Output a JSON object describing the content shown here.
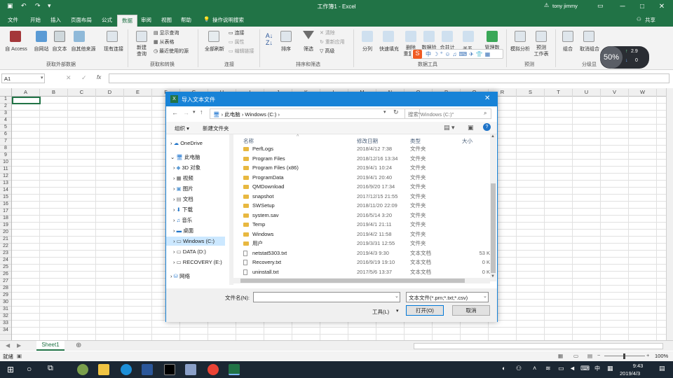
{
  "window": {
    "title": "工作簿1 - Excel",
    "user": "tony jimmy",
    "share": "共享"
  },
  "tabs": [
    "文件",
    "开始",
    "插入",
    "页面布局",
    "公式",
    "数据",
    "审阅",
    "视图",
    "帮助",
    "操作说明搜索"
  ],
  "ribbon": {
    "get_external": {
      "buttons": [
        "自 Access",
        "自网站",
        "自文本",
        "自其他来源",
        "现有连接"
      ],
      "group": "获取外部数据"
    },
    "get_transform": {
      "new_query": "新建\n查询",
      "items": [
        "显示查询",
        "从表格",
        "最近使用的源"
      ],
      "group": "获取和转换"
    },
    "connections": {
      "refresh": "全部刷新",
      "items": [
        "连接",
        "属性",
        "编辑链接"
      ],
      "group": "连接"
    },
    "sort_filter": {
      "buttons": [
        "排序",
        "筛选"
      ],
      "items": [
        "清除",
        "重新应用",
        "高级"
      ],
      "group": "排序和筛选"
    },
    "data_tools": {
      "buttons": [
        "分列",
        "快速填充",
        "删除\n重复项",
        "数据验\n证",
        "合并计\n算",
        "关系",
        "管理数\n据模型"
      ],
      "group": "数据工具"
    },
    "forecast": {
      "buttons": [
        "模拟分析",
        "预测\n工作表"
      ],
      "group": "预测"
    },
    "outline": {
      "buttons": [
        "组合",
        "取消组合",
        "分类汇总"
      ],
      "group": "分级显示"
    }
  },
  "ime_percent": "50%",
  "net": {
    "up": "2.9",
    "down": "0"
  },
  "formula_bar": {
    "namebox": "A1",
    "fx": "fx"
  },
  "columns": [
    "A",
    "B",
    "C",
    "D",
    "E",
    "F",
    "G",
    "H",
    "I",
    "J",
    "K",
    "L",
    "M",
    "N",
    "O",
    "P",
    "Q",
    "R",
    "S",
    "T",
    "U",
    "V",
    "W"
  ],
  "rows": [
    "1",
    "2",
    "3",
    "4",
    "5",
    "6",
    "7",
    "8",
    "9",
    "10",
    "11",
    "12",
    "13",
    "14",
    "15",
    "16",
    "17",
    "18",
    "19",
    "20",
    "21",
    "22",
    "23",
    "24",
    "25",
    "26",
    "27",
    "28",
    "29",
    "30",
    "31",
    "32",
    "33",
    "34"
  ],
  "sheet": {
    "name": "Sheet1",
    "status": "就绪",
    "zoom": "100%"
  },
  "dialog": {
    "title": "导入文本文件",
    "breadcrumb": [
      "此电脑",
      "Windows (C:)"
    ],
    "search_placeholder": "搜索\"Windows (C:)\"",
    "organize": "组织 ▾",
    "new_folder": "新建文件夹",
    "nav": [
      {
        "label": "OneDrive"
      },
      {
        "label": "此电脑"
      },
      {
        "label": "3D 对象"
      },
      {
        "label": "视频"
      },
      {
        "label": "图片"
      },
      {
        "label": "文档"
      },
      {
        "label": "下载"
      },
      {
        "label": "音乐"
      },
      {
        "label": "桌面"
      },
      {
        "label": "Windows (C:)"
      },
      {
        "label": "DATA (D:)"
      },
      {
        "label": "RECOVERY (E:)"
      },
      {
        "label": "网络"
      }
    ],
    "headers": {
      "name": "名称",
      "date": "修改日期",
      "type": "类型",
      "size": "大小"
    },
    "files": [
      {
        "name": "PerfLogs",
        "date": "2018/4/12 7:38",
        "type": "文件夹",
        "size": "",
        "folder": true
      },
      {
        "name": "Program Files",
        "date": "2018/12/16 13:34",
        "type": "文件夹",
        "size": "",
        "folder": true
      },
      {
        "name": "Program Files (x86)",
        "date": "2019/4/1 10:24",
        "type": "文件夹",
        "size": "",
        "folder": true
      },
      {
        "name": "ProgramData",
        "date": "2019/4/1 20:40",
        "type": "文件夹",
        "size": "",
        "folder": true
      },
      {
        "name": "QMDownload",
        "date": "2016/9/20 17:34",
        "type": "文件夹",
        "size": "",
        "folder": true
      },
      {
        "name": "snapshot",
        "date": "2017/12/15 21:55",
        "type": "文件夹",
        "size": "",
        "folder": true
      },
      {
        "name": "SWSetup",
        "date": "2018/11/20 22:09",
        "type": "文件夹",
        "size": "",
        "folder": true
      },
      {
        "name": "system.sav",
        "date": "2016/5/14 3:20",
        "type": "文件夹",
        "size": "",
        "folder": true
      },
      {
        "name": "Temp",
        "date": "2019/4/1 21:11",
        "type": "文件夹",
        "size": "",
        "folder": true
      },
      {
        "name": "Windows",
        "date": "2019/4/2 11:58",
        "type": "文件夹",
        "size": "",
        "folder": true
      },
      {
        "name": "用户",
        "date": "2019/3/31 12:55",
        "type": "文件夹",
        "size": "",
        "folder": true
      },
      {
        "name": "netstat5303.txt",
        "date": "2019/4/3 9:30",
        "type": "文本文档",
        "size": "53 K",
        "folder": false
      },
      {
        "name": "Recovery.txt",
        "date": "2016/9/19 19:10",
        "type": "文本文档",
        "size": "0 K",
        "folder": false
      },
      {
        "name": "uninstall.txt",
        "date": "2017/5/6 13:37",
        "type": "文本文档",
        "size": "0 K",
        "folder": false
      }
    ],
    "filename_label": "文件名(N):",
    "filetype": "文本文件(*.prn;*.txt;*.csv)",
    "tools": "工具(L)",
    "open": "打开(O)",
    "cancel": "取消"
  },
  "taskbar": {
    "time": "9:43",
    "date": "2019/4/3",
    "ime": "中"
  }
}
